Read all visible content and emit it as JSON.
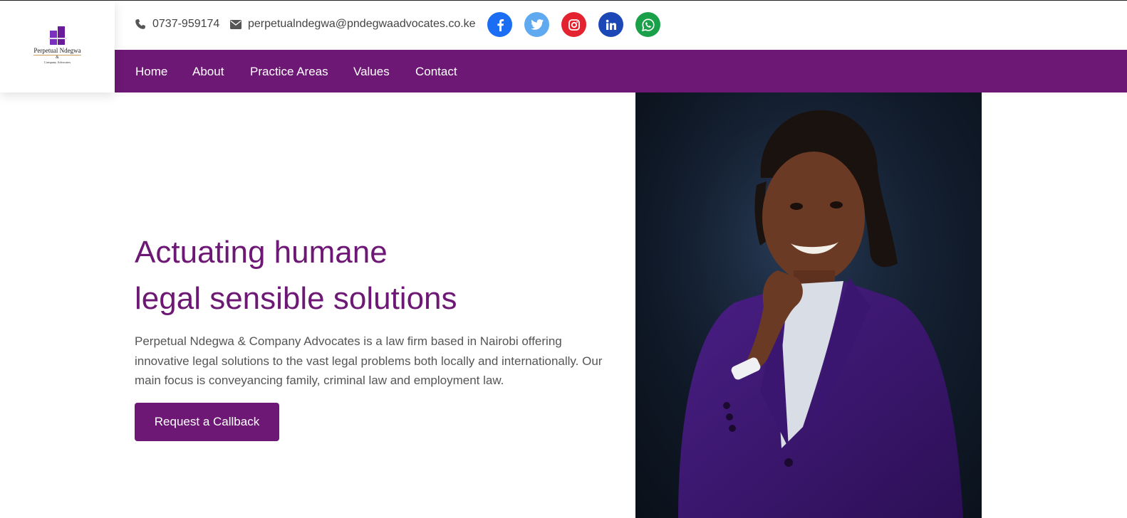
{
  "logo": {
    "name": "Perpetual Ndegwa",
    "amp": "&",
    "subtitle": "Company Advocates"
  },
  "contact": {
    "phone": "0737-959174",
    "email": "perpetualndegwa@pndegwaadvocates.co.ke"
  },
  "social": [
    {
      "name": "facebook-icon",
      "color": "#1b6ef3"
    },
    {
      "name": "twitter-icon",
      "color": "#5ea9f0"
    },
    {
      "name": "instagram-icon",
      "color": "#e3232f"
    },
    {
      "name": "linkedin-icon",
      "color": "#1c47b6"
    },
    {
      "name": "whatsapp-icon",
      "color": "#1ba04a"
    }
  ],
  "nav": {
    "home": "Home",
    "about": "About",
    "practice": "Practice Areas",
    "values": "Values",
    "contact": "Contact"
  },
  "hero": {
    "title_line1": "Actuating humane",
    "title_line2": "legal sensible solutions",
    "text": "Perpetual Ndegwa & Company Advocates is a law firm based in Nairobi offering innovative legal solutions to the vast legal problems both locally and internationally. Our main focus is conveyancing family, criminal law and employment law.",
    "cta": "Request a Callback"
  },
  "colors": {
    "brand": "#6d1874",
    "text": "#555555"
  }
}
